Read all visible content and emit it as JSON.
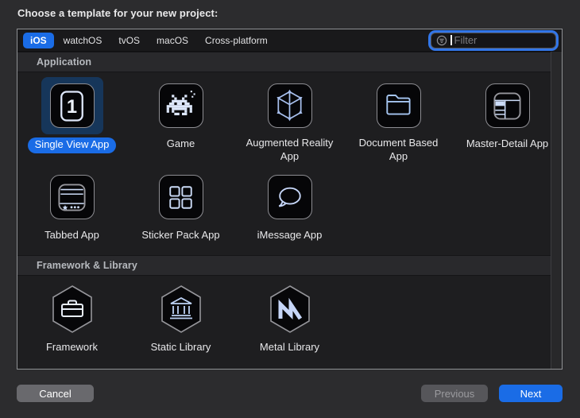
{
  "window": {
    "title": "Choose a template for your new project:"
  },
  "colors": {
    "accent": "#1a6ce6",
    "selection_background": "#16365a",
    "focus_ring": "#3276e8",
    "icon_glyph": "#c9dbf8"
  },
  "tabs": [
    {
      "label": "iOS",
      "selected": true
    },
    {
      "label": "watchOS",
      "selected": false
    },
    {
      "label": "tvOS",
      "selected": false
    },
    {
      "label": "macOS",
      "selected": false
    },
    {
      "label": "Cross-platform",
      "selected": false
    }
  ],
  "filter": {
    "placeholder": "Filter",
    "icon": "filter-icon"
  },
  "sections": [
    {
      "title": "Application",
      "items": [
        {
          "label": "Single View App",
          "icon": "single-view-app",
          "shape": "square",
          "selected": true
        },
        {
          "label": "Game",
          "icon": "game",
          "shape": "square",
          "selected": false
        },
        {
          "label": "Augmented Reality App",
          "icon": "augmented-reality",
          "shape": "square",
          "selected": false
        },
        {
          "label": "Document Based App",
          "icon": "document-based",
          "shape": "square",
          "selected": false
        },
        {
          "label": "Master-Detail App",
          "icon": "master-detail",
          "shape": "square",
          "selected": false
        },
        {
          "label": "Tabbed App",
          "icon": "tabbed",
          "shape": "square",
          "selected": false
        },
        {
          "label": "Sticker Pack App",
          "icon": "sticker-pack",
          "shape": "square",
          "selected": false
        },
        {
          "label": "iMessage App",
          "icon": "imessage",
          "shape": "square",
          "selected": false
        }
      ]
    },
    {
      "title": "Framework & Library",
      "items": [
        {
          "label": "Framework",
          "icon": "framework",
          "shape": "hexagon",
          "selected": false
        },
        {
          "label": "Static Library",
          "icon": "static-library",
          "shape": "hexagon",
          "selected": false
        },
        {
          "label": "Metal Library",
          "icon": "metal-library",
          "shape": "hexagon",
          "selected": false
        }
      ]
    }
  ],
  "footer": {
    "cancel_label": "Cancel",
    "previous_label": "Previous",
    "next_label": "Next",
    "previous_enabled": false
  }
}
